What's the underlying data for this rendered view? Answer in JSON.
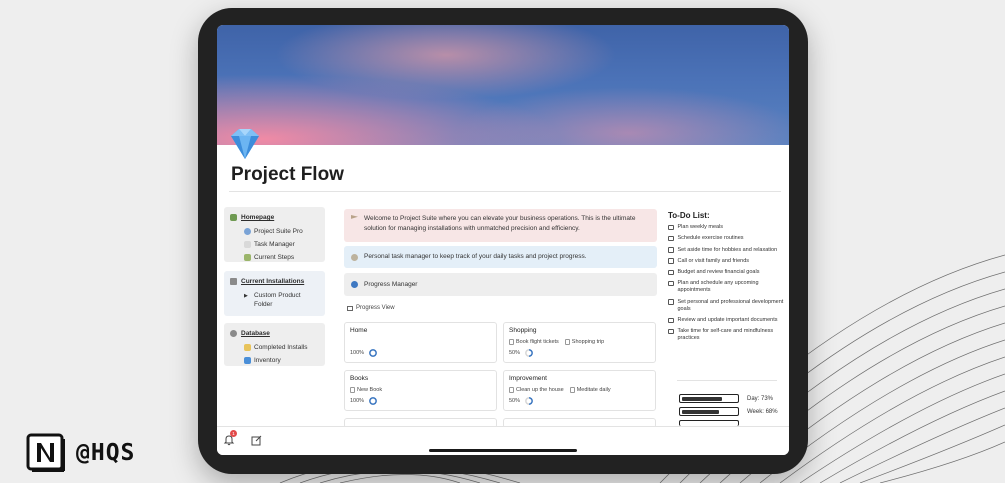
{
  "page": {
    "title": "Project Flow"
  },
  "sidebar": {
    "groups": [
      {
        "heading": "Homepage",
        "items": [
          "Project Suite Pro",
          "Task Manager",
          "Current Steps"
        ]
      },
      {
        "heading": "Current Installations",
        "items": [
          "Custom Product Folder"
        ]
      },
      {
        "heading": "Database",
        "items": [
          "Completed Installs",
          "Inventory"
        ]
      }
    ]
  },
  "callouts": {
    "welcome": "Welcome to Project Suite where you can elevate your business operations. This is the ultimate solution for managing installations with unmatched precision and efficiency.",
    "task_manager": "Personal task manager to keep track of your daily tasks and project progress.",
    "progress_manager": "Progress Manager"
  },
  "progress_view": {
    "label": "Progress View",
    "cards": [
      {
        "title": "Home",
        "links": [],
        "percent": "100%",
        "progress": 1.0
      },
      {
        "title": "Shopping",
        "links": [
          "Book flight tickets",
          "Shopping trip"
        ],
        "percent": "50%",
        "progress": 0.5
      },
      {
        "title": "Books",
        "links": [
          "New Book"
        ],
        "percent": "100%",
        "progress": 1.0
      },
      {
        "title": "Improvement",
        "links": [
          "Clean up the house",
          "Meditate daily"
        ],
        "percent": "50%",
        "progress": 0.5
      }
    ]
  },
  "todo": {
    "title": "To-Do List:",
    "items": [
      "Plan weekly meals",
      "Schedule exercise routines",
      "Set aside time for hobbies and relaxation",
      "Call or visit family and friends",
      "Budget and review financial goals",
      "Plan and schedule any upcoming appointments",
      "Set personal and professional development goals",
      "Review and update important documents",
      "Take time for self-care and mindfulness practices"
    ],
    "progress": [
      {
        "label": "Day: 73%",
        "value": 0.73
      },
      {
        "label": "Week: 68%",
        "value": 0.68
      }
    ]
  },
  "footer": {
    "notification_count": "1"
  },
  "brand": {
    "handle": "@HQS"
  },
  "colors": {
    "callout_pink": "#f7e6e6",
    "callout_blue": "#e4eff8",
    "callout_gray": "#eeeeee",
    "ring_blue": "#3f79c2",
    "badge_red": "#e24a4a"
  },
  "icons": {
    "page": "diamond-gem-icon",
    "homepage": "house-plant-icon",
    "project_suite_pro": "pin-icon",
    "task_manager": "clipboard-icon",
    "current_steps": "steps-icon",
    "current_installations": "box-icon",
    "custom_product_folder": "triangle-right-icon",
    "database": "gear-icon",
    "completed_installs": "folder-icon",
    "inventory": "tag-icon",
    "welcome": "flag-icon",
    "task": "moon-icon",
    "progress": "blue-circle-icon",
    "bell": "bell-icon",
    "compose": "compose-icon",
    "notion": "notion-logo"
  }
}
